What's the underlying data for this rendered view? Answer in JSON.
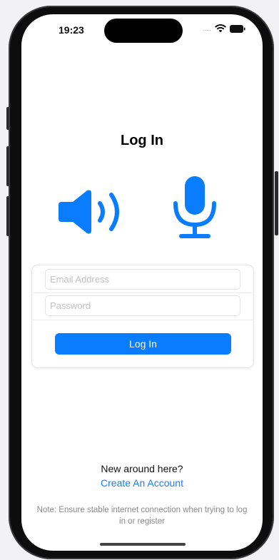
{
  "status_bar": {
    "time": "19:23",
    "signal": "....",
    "icons": [
      "wifi-icon",
      "battery-icon"
    ]
  },
  "screen": {
    "title": "Log In",
    "icons": [
      "speaker-icon",
      "microphone-icon"
    ],
    "accent_color": "#0a7dff"
  },
  "form": {
    "email_placeholder": "Email Address",
    "email_value": "",
    "password_placeholder": "Password",
    "password_value": "",
    "login_label": "Log In"
  },
  "footer": {
    "prompt": "New around here?",
    "create_link": "Create An Account",
    "note": "Note: Ensure stable internet connection when trying to log in or register"
  }
}
